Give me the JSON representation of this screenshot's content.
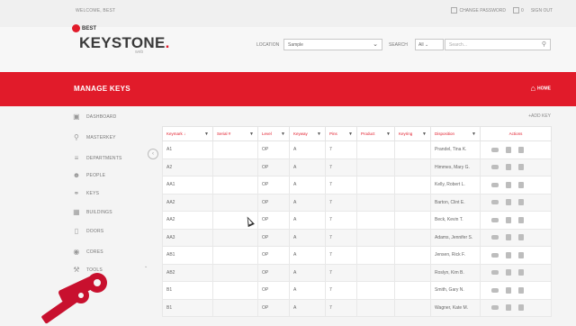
{
  "topbar": {
    "welcome": "WELCOME, BEST",
    "change_password": "CHANGE PASSWORD",
    "messages_count": "0",
    "sign_out": "SIGN OUT"
  },
  "header": {
    "brand_small": "BEST",
    "brand_main": "KEYSTONE",
    "brand_dot": ".",
    "brand_sub": "web",
    "location_label": "LOCATION",
    "location_value": "Sample",
    "search_label": "SEARCH",
    "search_filter": "All",
    "search_placeholder": "Search..."
  },
  "banner": {
    "title": "MANAGE KEYS",
    "home": "HOME"
  },
  "sidebar": {
    "items": [
      {
        "label": "DASHBOARD",
        "icon": "dashboard-icon"
      },
      {
        "label": "MASTERKEY",
        "icon": "key-icon"
      },
      {
        "label": "DEPARTMENTS",
        "icon": "departments-icon"
      },
      {
        "label": "PEOPLE",
        "icon": "people-icon"
      },
      {
        "label": "KEYS",
        "icon": "keys-icon"
      },
      {
        "label": "BUILDINGS",
        "icon": "buildings-icon"
      },
      {
        "label": "DOORS",
        "icon": "door-icon"
      },
      {
        "label": "CORES",
        "icon": "lock-icon"
      },
      {
        "label": "TOOLS",
        "icon": "tools-icon"
      }
    ]
  },
  "main": {
    "add_key": "+ADD KEY",
    "columns": [
      "Keymark ↓",
      "Serial #",
      "Level",
      "Keyway",
      "Pins",
      "Product",
      "Keyring",
      "Disposition",
      "Actions"
    ],
    "rows": [
      [
        "A1",
        "",
        "OP",
        "A",
        "7",
        "",
        "",
        "Prandel, Tina K."
      ],
      [
        "A2",
        "",
        "OP",
        "A",
        "7",
        "",
        "",
        "Himmes, Mary G."
      ],
      [
        "AA1",
        "",
        "OP",
        "A",
        "7",
        "",
        "",
        "Kelly, Robert L."
      ],
      [
        "AA2",
        "",
        "OP",
        "A",
        "7",
        "",
        "",
        "Barton, Clint E."
      ],
      [
        "AA2",
        "",
        "OP",
        "A",
        "7",
        "",
        "",
        "Beck, Kevin T."
      ],
      [
        "AA3",
        "",
        "OP",
        "A",
        "7",
        "",
        "",
        "Adams, Jennifer S."
      ],
      [
        "AB1",
        "",
        "OP",
        "A",
        "7",
        "",
        "",
        "Jensen, Rick F."
      ],
      [
        "AB2",
        "",
        "OP",
        "A",
        "7",
        "",
        "",
        "Roslyn, Kim B."
      ],
      [
        "B1",
        "",
        "OP",
        "A",
        "7",
        "",
        "",
        "Smith, Gary N."
      ],
      [
        "B1",
        "",
        "OP",
        "A",
        "7",
        "",
        "",
        "Wagner, Kate M."
      ]
    ]
  },
  "colors": {
    "accent": "#e11b2a",
    "background": "#f4f4f4"
  }
}
